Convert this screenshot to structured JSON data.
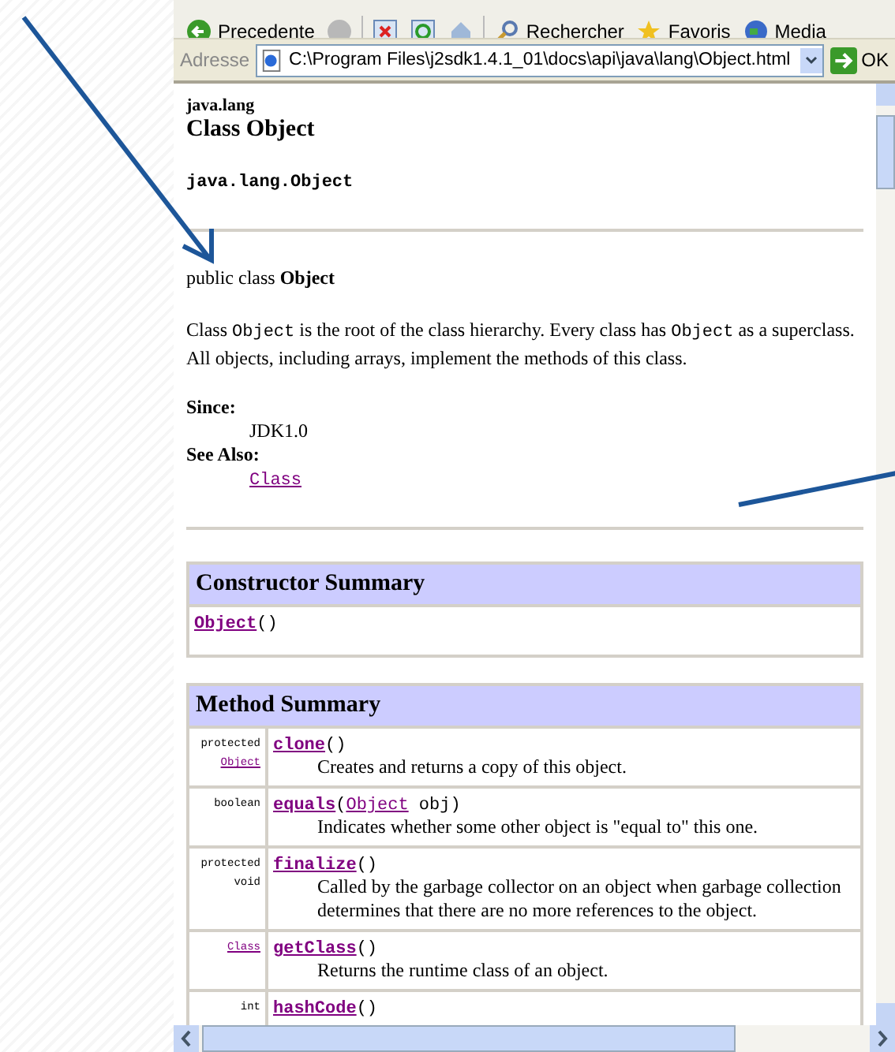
{
  "toolbar": {
    "buttons": [
      {
        "label": "Precedente",
        "kind": "back"
      },
      {
        "kind": "forward"
      },
      {
        "kind": "stop"
      },
      {
        "kind": "refresh"
      },
      {
        "kind": "home"
      },
      {
        "label": "Rechercher",
        "kind": "search"
      },
      {
        "label": "Favoris",
        "kind": "favorites"
      },
      {
        "label": "Media",
        "kind": "media"
      }
    ]
  },
  "address_bar": {
    "label": "Adresse",
    "value": "C:\\Program Files\\j2sdk1.4.1_01\\docs\\api\\java\\lang\\Object.html",
    "go": "OK"
  },
  "page": {
    "package": "java.lang",
    "title": "Class Object",
    "hierarchy": "java.lang.Object",
    "declaration": "public class **Object**",
    "description": [
      {
        "text": "Class ",
        "kind": "plain"
      },
      {
        "text": "Object",
        "kind": "code"
      },
      {
        "text": " is the root of the class hierarchy. Every class has ",
        "kind": "plain"
      },
      {
        "text": "Object",
        "kind": "code"
      },
      {
        "text": " as a superclass. All objects, including arrays, implement the methods of this class.",
        "kind": "plain"
      }
    ],
    "since_label": "Since:",
    "since": "JDK1.0",
    "see_also_label": "See Also:",
    "see_also": "Class",
    "constructor_summary": {
      "title": "Constructor Summary",
      "rows": [
        {
          "signature": [
            {
              "text": "Object",
              "kind": "name"
            },
            {
              "text": "()",
              "kind": "plain"
            }
          ]
        }
      ]
    },
    "method_summary": {
      "title": "Method Summary",
      "rows": [
        {
          "modifier": [
            {
              "text": "protected",
              "kind": "plain"
            },
            {
              "text": "Object",
              "kind": "link"
            }
          ],
          "signature": [
            {
              "text": "clone",
              "kind": "name"
            },
            {
              "text": "()",
              "kind": "plain"
            }
          ],
          "description": "Creates and returns a copy of this object."
        },
        {
          "modifier": [
            {
              "text": "boolean",
              "kind": "plain"
            }
          ],
          "signature": [
            {
              "text": "equals",
              "kind": "name"
            },
            {
              "text": "(",
              "kind": "plain"
            },
            {
              "text": "Object",
              "kind": "link"
            },
            {
              "text": " obj)",
              "kind": "plain"
            }
          ],
          "description": "Indicates whether some other object is \"equal to\" this one."
        },
        {
          "modifier": [
            {
              "text": "protected",
              "kind": "plain"
            },
            {
              "text": "void",
              "kind": "plain"
            }
          ],
          "signature": [
            {
              "text": "finalize",
              "kind": "name"
            },
            {
              "text": "()",
              "kind": "plain"
            }
          ],
          "description": "Called by the garbage collector on an object when garbage collection determines that there are no more references to the object."
        },
        {
          "modifier": [
            {
              "text": "Class",
              "kind": "link"
            }
          ],
          "signature": [
            {
              "text": "getClass",
              "kind": "name"
            },
            {
              "text": "()",
              "kind": "plain"
            }
          ],
          "description": "Returns the runtime class of an object."
        },
        {
          "modifier": [
            {
              "text": "int",
              "kind": "plain"
            }
          ],
          "signature": [
            {
              "text": "hashCode",
              "kind": "name"
            },
            {
              "text": "()",
              "kind": "plain"
            }
          ]
        }
      ]
    }
  }
}
